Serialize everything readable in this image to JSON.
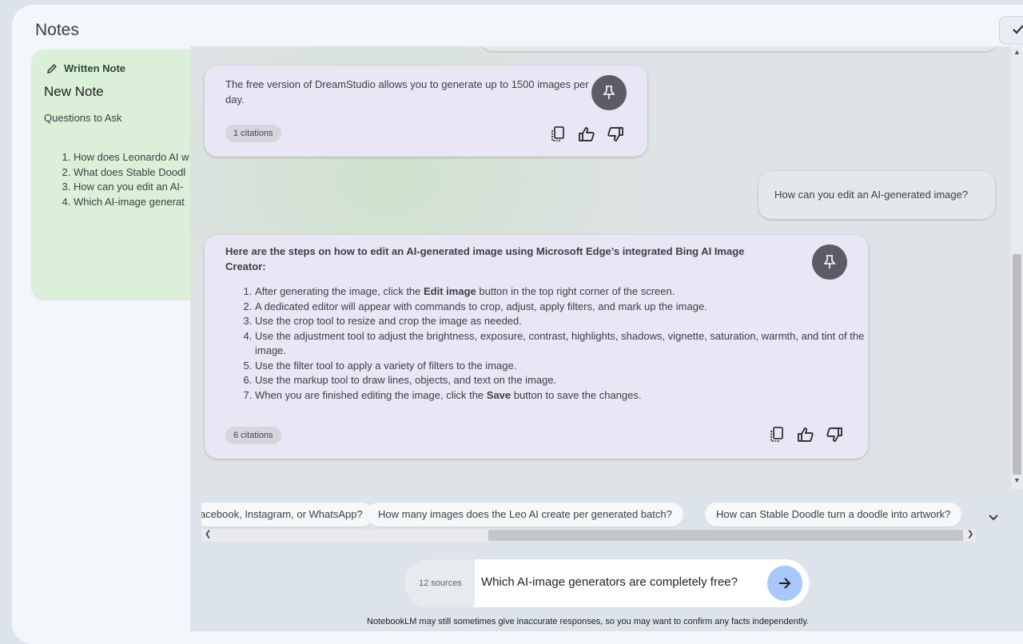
{
  "notes": {
    "title": "Notes",
    "card": {
      "kind_label": "Written Note",
      "title": "New Note",
      "subtitle": "Questions to Ask",
      "items": [
        "How does Leonardo AI w",
        "What does Stable Doodl",
        "How can you edit an AI-",
        "Which AI-image generat"
      ]
    }
  },
  "chat": {
    "messages": [
      {
        "text": "The free version of DreamStudio allows you to generate up to 1500 images per day.",
        "citations": "1 citations"
      },
      {
        "text": "How can you edit an AI-generated image?"
      },
      {
        "title": "Here are the steps on how to edit an AI-generated image using Microsoft Edge’s integrated Bing AI Image Creator:",
        "steps": [
          {
            "pre": "After generating the image, click the ",
            "bold": "Edit image",
            "post": " button in the top right corner of the screen."
          },
          {
            "pre": "A dedicated editor will appear with commands to crop, adjust, apply filters, and mark up the image.",
            "bold": "",
            "post": ""
          },
          {
            "pre": "Use the crop tool to resize and crop the image as needed.",
            "bold": "",
            "post": ""
          },
          {
            "pre": "Use the adjustment tool to adjust the brightness, exposure, contrast, highlights, shadows, vignette, saturation, warmth, and tint of the image.",
            "bold": "",
            "post": ""
          },
          {
            "pre": "Use the filter tool to apply a variety of filters to the image.",
            "bold": "",
            "post": ""
          },
          {
            "pre": "Use the markup tool to draw lines, objects, and text on the image.",
            "bold": "",
            "post": ""
          },
          {
            "pre": "When you are finished editing the image, click the ",
            "bold": "Save",
            "post": " button to save the changes."
          }
        ],
        "citations": "6 citations"
      }
    ]
  },
  "suggestions": [
    "Facebook, Instagram, or WhatsApp?",
    "How many images does the Leo AI create per generated batch?",
    "How can Stable Doodle turn a doodle into artwork?"
  ],
  "input": {
    "sources": "12 sources",
    "value": "Which AI-image generators are completely free?"
  },
  "disclaimer": "NotebookLM may still sometimes give inaccurate responses, so you may want to confirm any facts independently."
}
